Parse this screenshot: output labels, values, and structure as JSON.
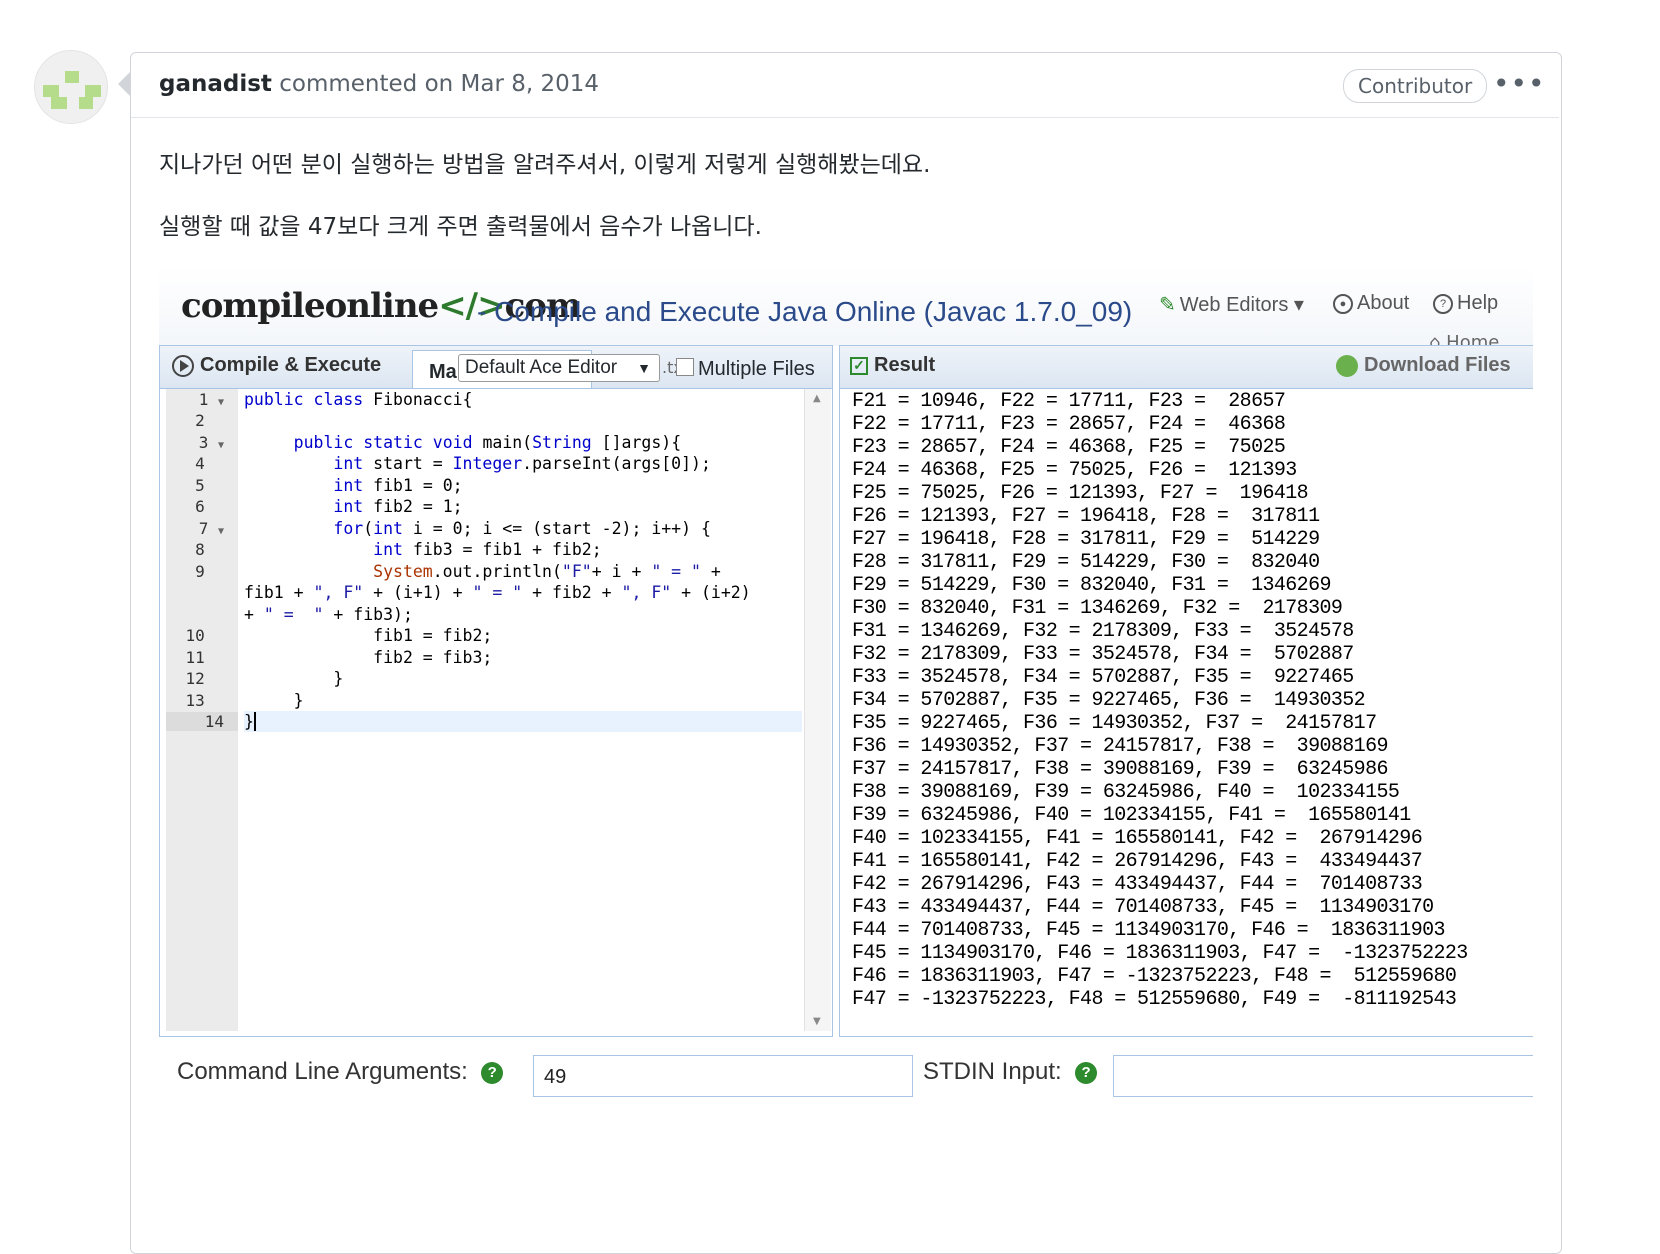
{
  "comment": {
    "author": "ganadist",
    "meta": "commented on Mar 8, 2014",
    "badge": "Contributor",
    "more": "•••",
    "paragraphs": [
      "지나가던 어떤 분이 실행하는 방법을 알려주셔서, 이렇게 저렇게 실행해봤는데요.",
      "실행할 때 값을 47보다 크게 주면 출력물에서 음수가 나옵니다."
    ]
  },
  "site": {
    "logo_text": "compileonline",
    "logo_tag": "</>",
    "logo_suffix": "com",
    "subtitle": "- Compile and Execute Java Online (Javac 1.7.0_09)",
    "nav": {
      "web_editors": "Web Editors",
      "about": "About",
      "help": "Help",
      "home": "Home"
    }
  },
  "editor": {
    "compile_tab": "Compile & Execute",
    "main_tab": "Ma",
    "theme_select": "Default Ace Editor",
    "txt_fragment": ".tx",
    "multiple_files": "Multiple Files",
    "line_numbers": [
      "1",
      "2",
      "3",
      "4",
      "5",
      "6",
      "7",
      "8",
      "9",
      "",
      "",
      "10",
      "11",
      "12",
      "13",
      "14"
    ]
  },
  "result": {
    "title": "Result",
    "download": "Download Files",
    "lines": [
      "F21 = 10946, F22 = 17711, F23 =  28657",
      "F22 = 17711, F23 = 28657, F24 =  46368",
      "F23 = 28657, F24 = 46368, F25 =  75025",
      "F24 = 46368, F25 = 75025, F26 =  121393",
      "F25 = 75025, F26 = 121393, F27 =  196418",
      "F26 = 121393, F27 = 196418, F28 =  317811",
      "F27 = 196418, F28 = 317811, F29 =  514229",
      "F28 = 317811, F29 = 514229, F30 =  832040",
      "F29 = 514229, F30 = 832040, F31 =  1346269",
      "F30 = 832040, F31 = 1346269, F32 =  2178309",
      "F31 = 1346269, F32 = 2178309, F33 =  3524578",
      "F32 = 2178309, F33 = 3524578, F34 =  5702887",
      "F33 = 3524578, F34 = 5702887, F35 =  9227465",
      "F34 = 5702887, F35 = 9227465, F36 =  14930352",
      "F35 = 9227465, F36 = 14930352, F37 =  24157817",
      "F36 = 14930352, F37 = 24157817, F38 =  39088169",
      "F37 = 24157817, F38 = 39088169, F39 =  63245986",
      "F38 = 39088169, F39 = 63245986, F40 =  102334155",
      "F39 = 63245986, F40 = 102334155, F41 =  165580141",
      "F40 = 102334155, F41 = 165580141, F42 =  267914296",
      "F41 = 165580141, F42 = 267914296, F43 =  433494437",
      "F42 = 267914296, F43 = 433494437, F44 =  701408733",
      "F43 = 433494437, F44 = 701408733, F45 =  1134903170",
      "F44 = 701408733, F45 = 1134903170, F46 =  1836311903",
      "F45 = 1134903170, F46 = 1836311903, F47 =  -1323752223",
      "F46 = 1836311903, F47 = -1323752223, F48 =  512559680",
      "F47 = -1323752223, F48 = 512559680, F49 =  -811192543"
    ]
  },
  "bottom": {
    "cmd_label": "Command Line Arguments:",
    "cmd_value": "49",
    "stdin_label": "STDIN Input:",
    "stdin_value": "",
    "help_glyph": "?"
  },
  "colors": {
    "accent_green": "#2d8a2d",
    "panel_border": "#aac4e4",
    "subtitle_blue": "#2a4a8a"
  }
}
